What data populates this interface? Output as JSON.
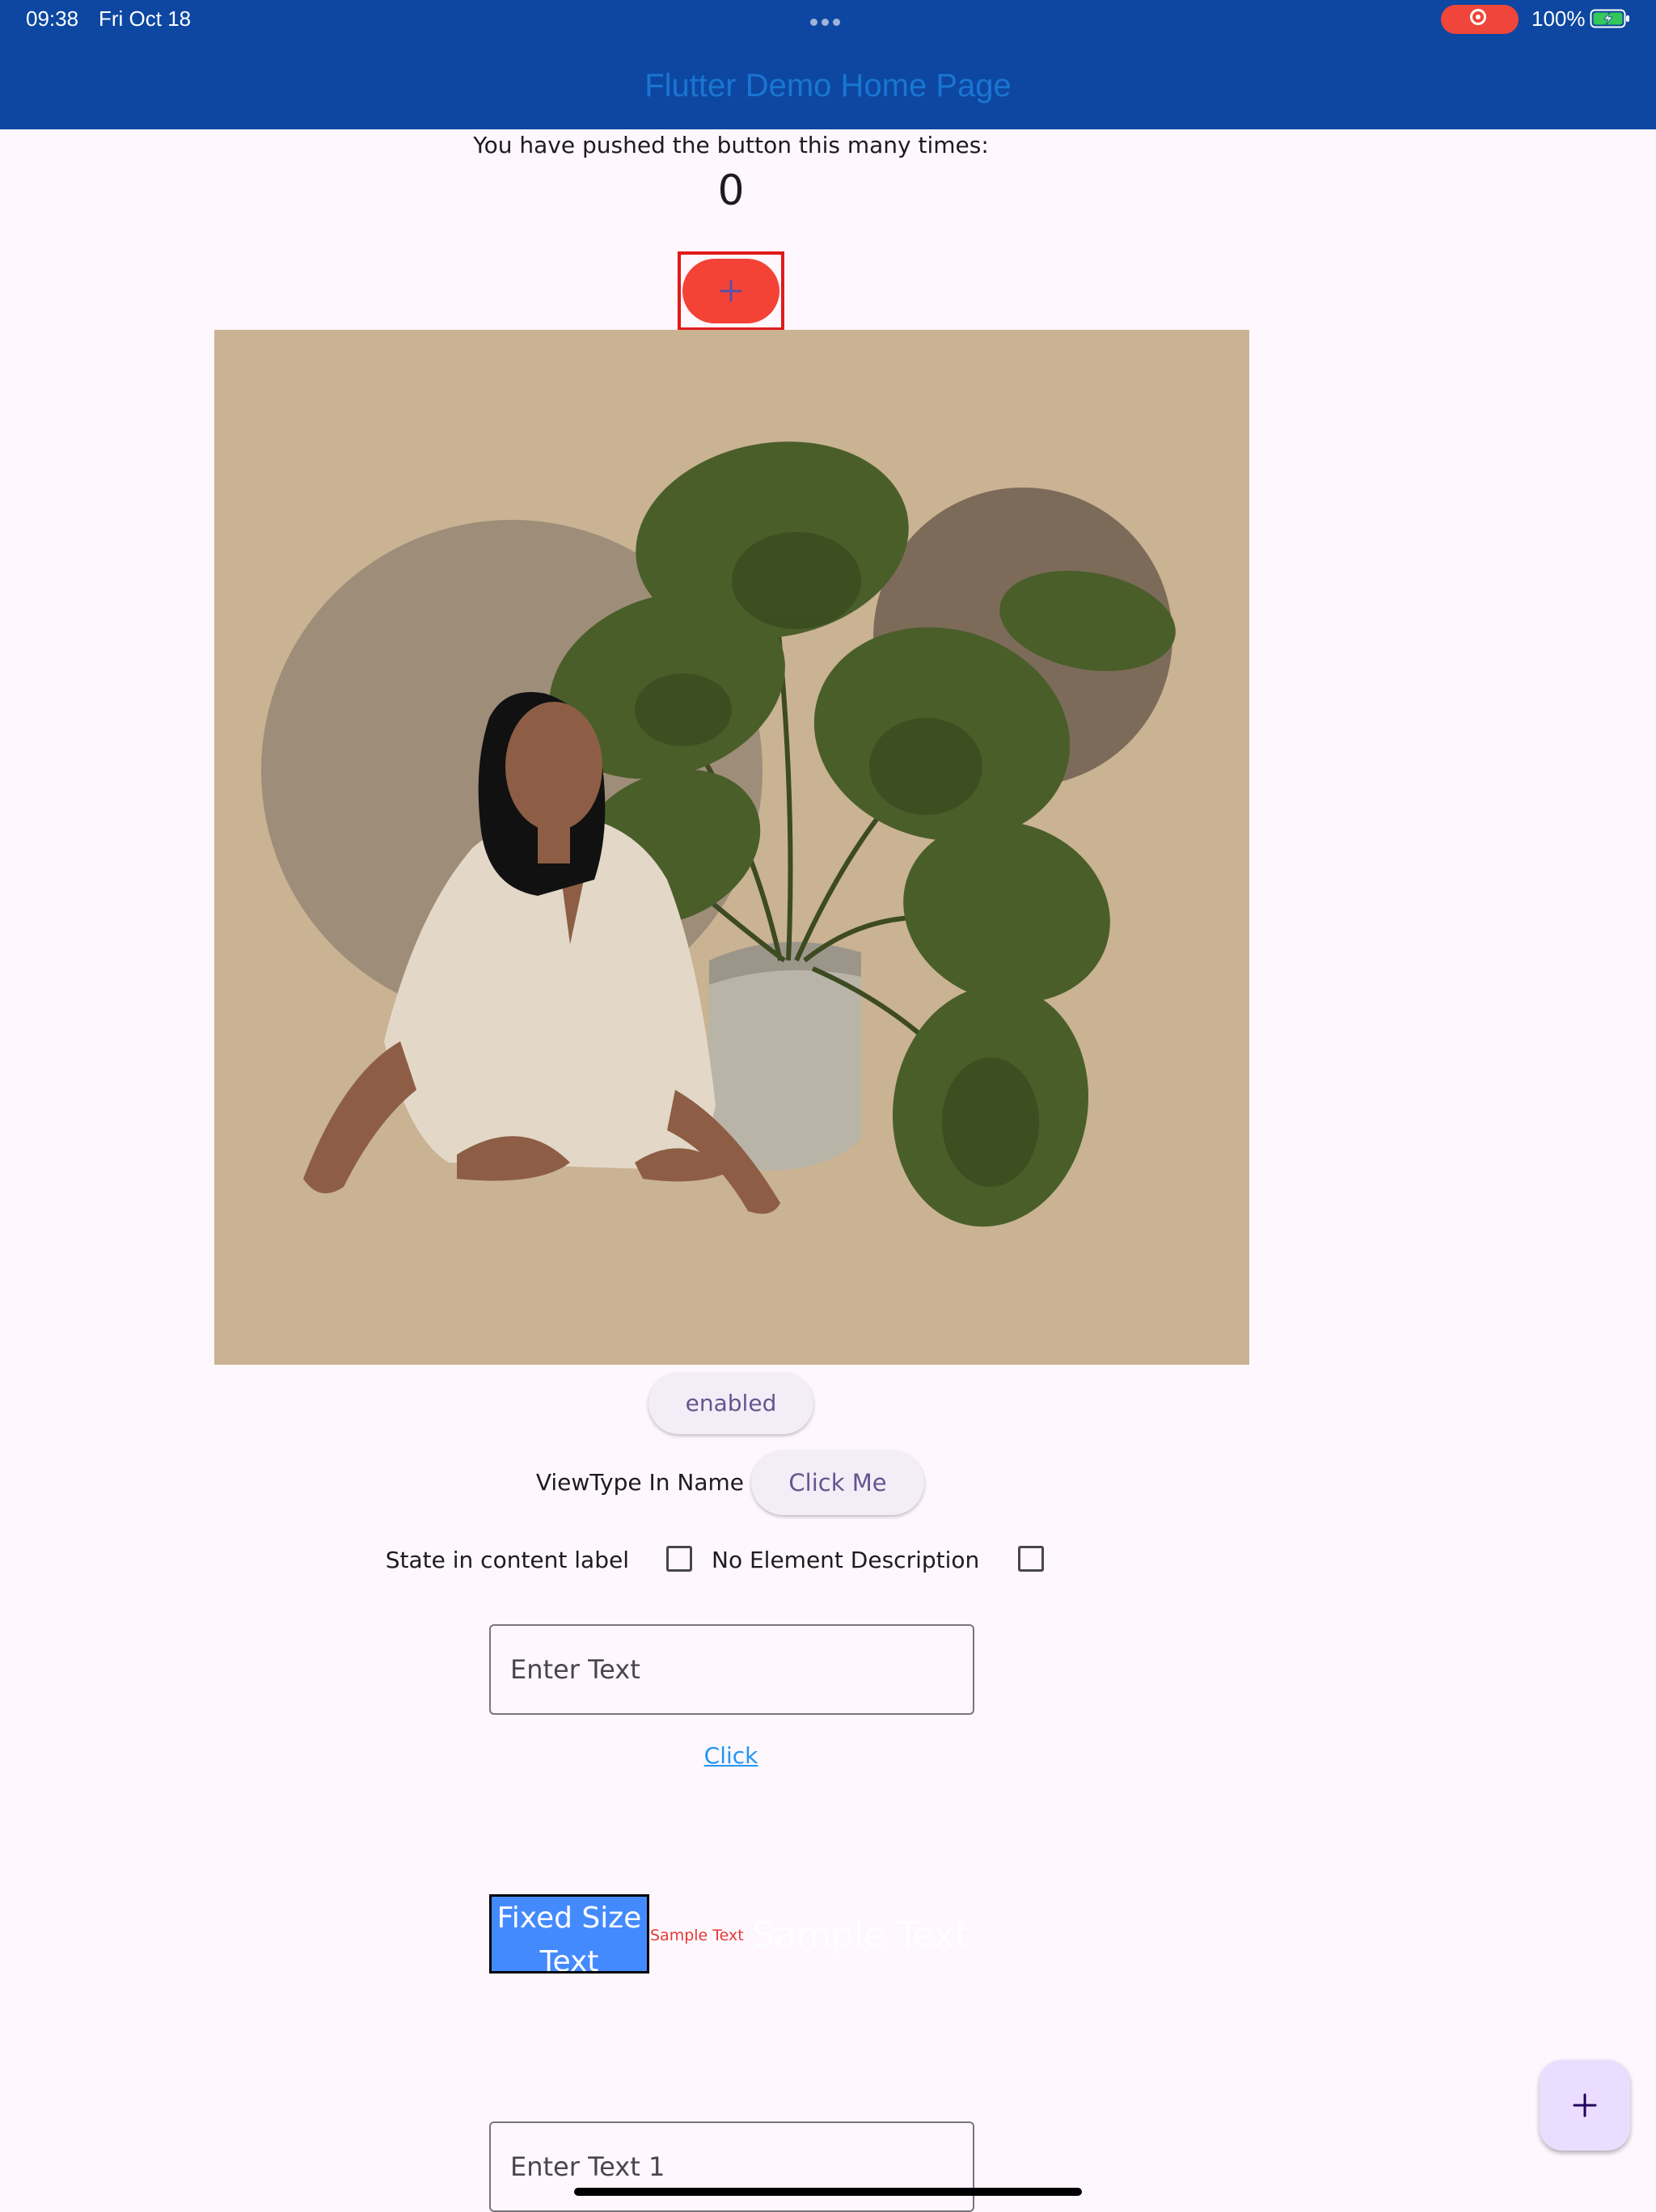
{
  "status_bar": {
    "time": "09:38",
    "date": "Fri Oct 18",
    "battery": "100%",
    "icons": [
      "more-dots-icon",
      "screen-record-icon",
      "battery-charging-icon"
    ]
  },
  "app_bar": {
    "title": "Flutter Demo Home Page",
    "background": "#0d47a1",
    "title_color": "#1976d2"
  },
  "counter": {
    "label": "You have pushed the button this many times:",
    "value": "0"
  },
  "increment_button": {
    "icon": "plus-icon",
    "color": "#f44336",
    "highlight_color": "#e01b1b"
  },
  "illustration": {
    "icon": "woman-with-plant-illustration"
  },
  "buttons": {
    "enabled": "enabled",
    "viewtype_label": "ViewType In Name",
    "click_me": "Click Me"
  },
  "checkboxes": {
    "state_label": "State in content label",
    "no_description_label": "No Element Description"
  },
  "fields": {
    "enter_text_placeholder": "Enter Text",
    "enter_text_1_placeholder": "Enter Text 1"
  },
  "link": {
    "label": "Click"
  },
  "fixed_box": {
    "text": "Fixed Size Text",
    "color": "#448aff"
  },
  "sample_texts": {
    "small": "Sample Text",
    "large": "Sample Text"
  },
  "fab": {
    "icon": "plus-icon",
    "color": "#eaddff"
  }
}
